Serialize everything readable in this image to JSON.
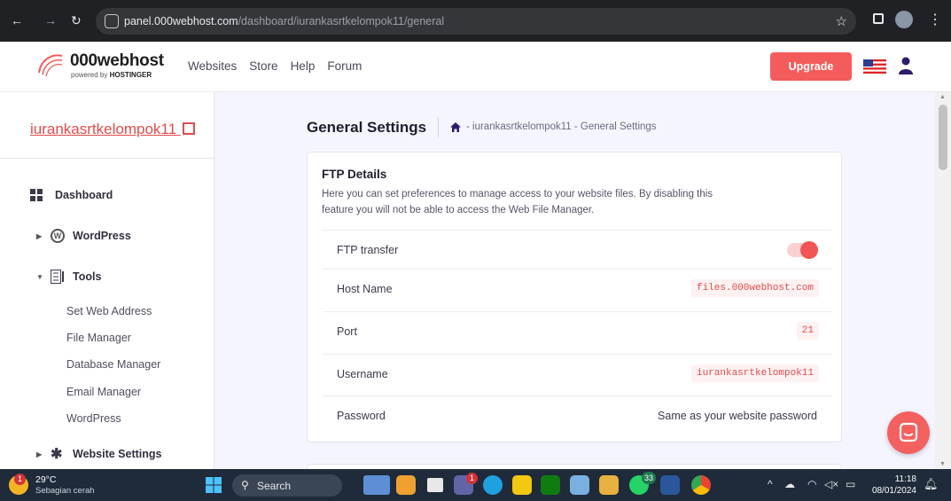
{
  "browser": {
    "url_host": "panel.000webhost.com",
    "url_path": "/dashboard/iurankasrtkelompok11/general"
  },
  "header": {
    "brand": "000webhost",
    "brand_sub_prefix": "powered by ",
    "brand_sub_name": "HOSTINGER",
    "nav": [
      "Websites",
      "Store",
      "Help",
      "Forum"
    ],
    "upgrade_label": "Upgrade"
  },
  "sidebar": {
    "site_name": "iurankasrtkelompok11",
    "items": {
      "dashboard": "Dashboard",
      "wordpress": "WordPress",
      "tools": "Tools",
      "website_settings": "Website Settings"
    },
    "tools_sub": [
      "Set Web Address",
      "File Manager",
      "Database Manager",
      "Email Manager",
      "WordPress"
    ]
  },
  "main": {
    "title": "General Settings",
    "breadcrumb": "- iurankasrtkelompok11 - General Settings"
  },
  "ftp": {
    "title": "FTP Details",
    "description": "Here you can set preferences to manage access to your website files. By disabling this feature you will not be able to access the Web File Manager.",
    "rows": {
      "transfer_label": "FTP transfer",
      "transfer_enabled": true,
      "host_label": "Host Name",
      "host_value": "files.000webhost.com",
      "port_label": "Port",
      "port_value": "21",
      "username_label": "Username",
      "username_value": "iurankasrtkelompok11",
      "password_label": "Password",
      "password_value": "Same as your website password"
    }
  },
  "taskbar": {
    "weather_temp": "29°C",
    "weather_desc": "Sebagian cerah",
    "weather_badge": "1",
    "search_label": "Search",
    "time": "11:18",
    "date": "08/01/2024",
    "badge_teams": "1",
    "badge_whatsapp": "33"
  },
  "colors": {
    "accent": "#f45c5c",
    "link": "#e04c4c",
    "page_bg": "#f4f5ff"
  }
}
